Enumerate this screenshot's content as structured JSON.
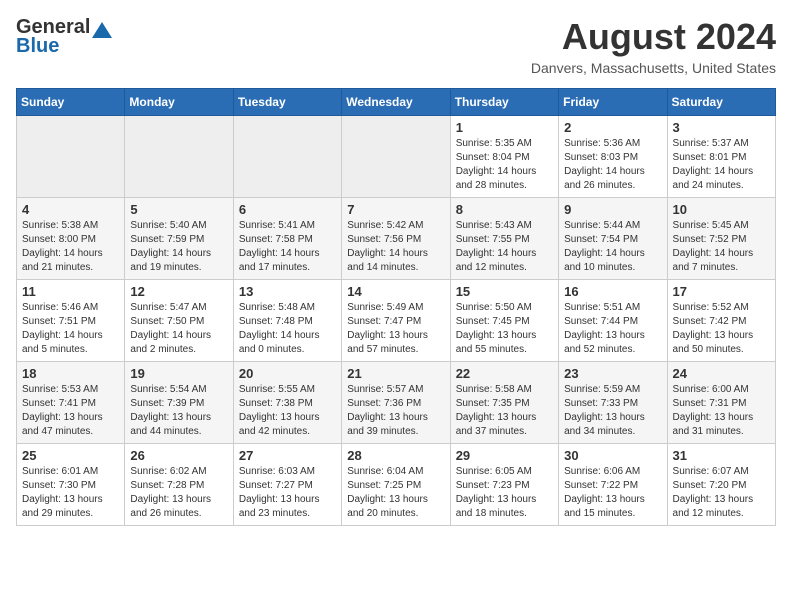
{
  "header": {
    "logo_general": "General",
    "logo_blue": "Blue",
    "month_year": "August 2024",
    "location": "Danvers, Massachusetts, United States"
  },
  "days_of_week": [
    "Sunday",
    "Monday",
    "Tuesday",
    "Wednesday",
    "Thursday",
    "Friday",
    "Saturday"
  ],
  "weeks": [
    [
      {
        "day": "",
        "info": ""
      },
      {
        "day": "",
        "info": ""
      },
      {
        "day": "",
        "info": ""
      },
      {
        "day": "",
        "info": ""
      },
      {
        "day": "1",
        "info": "Sunrise: 5:35 AM\nSunset: 8:04 PM\nDaylight: 14 hours\nand 28 minutes."
      },
      {
        "day": "2",
        "info": "Sunrise: 5:36 AM\nSunset: 8:03 PM\nDaylight: 14 hours\nand 26 minutes."
      },
      {
        "day": "3",
        "info": "Sunrise: 5:37 AM\nSunset: 8:01 PM\nDaylight: 14 hours\nand 24 minutes."
      }
    ],
    [
      {
        "day": "4",
        "info": "Sunrise: 5:38 AM\nSunset: 8:00 PM\nDaylight: 14 hours\nand 21 minutes."
      },
      {
        "day": "5",
        "info": "Sunrise: 5:40 AM\nSunset: 7:59 PM\nDaylight: 14 hours\nand 19 minutes."
      },
      {
        "day": "6",
        "info": "Sunrise: 5:41 AM\nSunset: 7:58 PM\nDaylight: 14 hours\nand 17 minutes."
      },
      {
        "day": "7",
        "info": "Sunrise: 5:42 AM\nSunset: 7:56 PM\nDaylight: 14 hours\nand 14 minutes."
      },
      {
        "day": "8",
        "info": "Sunrise: 5:43 AM\nSunset: 7:55 PM\nDaylight: 14 hours\nand 12 minutes."
      },
      {
        "day": "9",
        "info": "Sunrise: 5:44 AM\nSunset: 7:54 PM\nDaylight: 14 hours\nand 10 minutes."
      },
      {
        "day": "10",
        "info": "Sunrise: 5:45 AM\nSunset: 7:52 PM\nDaylight: 14 hours\nand 7 minutes."
      }
    ],
    [
      {
        "day": "11",
        "info": "Sunrise: 5:46 AM\nSunset: 7:51 PM\nDaylight: 14 hours\nand 5 minutes."
      },
      {
        "day": "12",
        "info": "Sunrise: 5:47 AM\nSunset: 7:50 PM\nDaylight: 14 hours\nand 2 minutes."
      },
      {
        "day": "13",
        "info": "Sunrise: 5:48 AM\nSunset: 7:48 PM\nDaylight: 14 hours\nand 0 minutes."
      },
      {
        "day": "14",
        "info": "Sunrise: 5:49 AM\nSunset: 7:47 PM\nDaylight: 13 hours\nand 57 minutes."
      },
      {
        "day": "15",
        "info": "Sunrise: 5:50 AM\nSunset: 7:45 PM\nDaylight: 13 hours\nand 55 minutes."
      },
      {
        "day": "16",
        "info": "Sunrise: 5:51 AM\nSunset: 7:44 PM\nDaylight: 13 hours\nand 52 minutes."
      },
      {
        "day": "17",
        "info": "Sunrise: 5:52 AM\nSunset: 7:42 PM\nDaylight: 13 hours\nand 50 minutes."
      }
    ],
    [
      {
        "day": "18",
        "info": "Sunrise: 5:53 AM\nSunset: 7:41 PM\nDaylight: 13 hours\nand 47 minutes."
      },
      {
        "day": "19",
        "info": "Sunrise: 5:54 AM\nSunset: 7:39 PM\nDaylight: 13 hours\nand 44 minutes."
      },
      {
        "day": "20",
        "info": "Sunrise: 5:55 AM\nSunset: 7:38 PM\nDaylight: 13 hours\nand 42 minutes."
      },
      {
        "day": "21",
        "info": "Sunrise: 5:57 AM\nSunset: 7:36 PM\nDaylight: 13 hours\nand 39 minutes."
      },
      {
        "day": "22",
        "info": "Sunrise: 5:58 AM\nSunset: 7:35 PM\nDaylight: 13 hours\nand 37 minutes."
      },
      {
        "day": "23",
        "info": "Sunrise: 5:59 AM\nSunset: 7:33 PM\nDaylight: 13 hours\nand 34 minutes."
      },
      {
        "day": "24",
        "info": "Sunrise: 6:00 AM\nSunset: 7:31 PM\nDaylight: 13 hours\nand 31 minutes."
      }
    ],
    [
      {
        "day": "25",
        "info": "Sunrise: 6:01 AM\nSunset: 7:30 PM\nDaylight: 13 hours\nand 29 minutes."
      },
      {
        "day": "26",
        "info": "Sunrise: 6:02 AM\nSunset: 7:28 PM\nDaylight: 13 hours\nand 26 minutes."
      },
      {
        "day": "27",
        "info": "Sunrise: 6:03 AM\nSunset: 7:27 PM\nDaylight: 13 hours\nand 23 minutes."
      },
      {
        "day": "28",
        "info": "Sunrise: 6:04 AM\nSunset: 7:25 PM\nDaylight: 13 hours\nand 20 minutes."
      },
      {
        "day": "29",
        "info": "Sunrise: 6:05 AM\nSunset: 7:23 PM\nDaylight: 13 hours\nand 18 minutes."
      },
      {
        "day": "30",
        "info": "Sunrise: 6:06 AM\nSunset: 7:22 PM\nDaylight: 13 hours\nand 15 minutes."
      },
      {
        "day": "31",
        "info": "Sunrise: 6:07 AM\nSunset: 7:20 PM\nDaylight: 13 hours\nand 12 minutes."
      }
    ]
  ]
}
